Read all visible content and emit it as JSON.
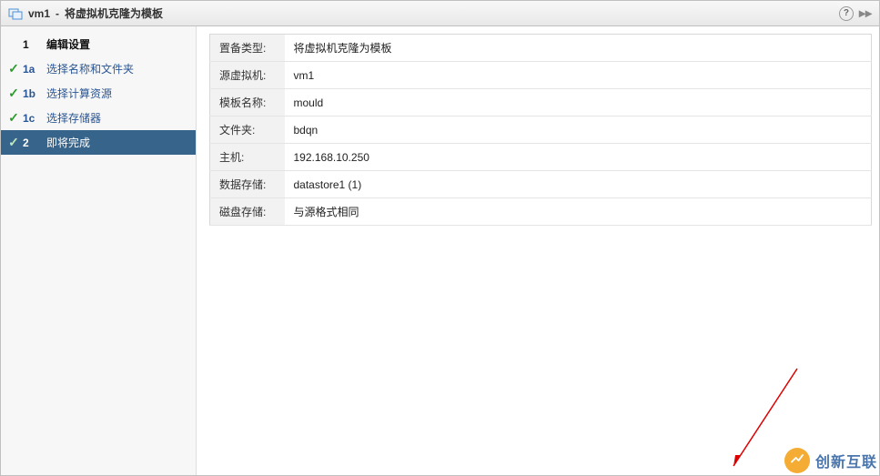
{
  "title": {
    "vm_name": "vm1",
    "separator": " - ",
    "action": "将虚拟机克隆为模板"
  },
  "sidebar": {
    "parent_number": "1",
    "parent_label": "编辑设置",
    "steps": [
      {
        "num": "1a",
        "label": "选择名称和文件夹",
        "checked": true
      },
      {
        "num": "1b",
        "label": "选择计算资源",
        "checked": true
      },
      {
        "num": "1c",
        "label": "选择存储器",
        "checked": true
      }
    ],
    "active_number": "2",
    "active_label": "即将完成"
  },
  "summary": [
    {
      "key": "置备类型:",
      "value": "将虚拟机克隆为模板"
    },
    {
      "key": "源虚拟机:",
      "value": "vm1"
    },
    {
      "key": "模板名称:",
      "value": "mould"
    },
    {
      "key": "文件夹:",
      "value": "bdqn"
    },
    {
      "key": "主机:",
      "value": "192.168.10.250"
    },
    {
      "key": "数据存储:",
      "value": "datastore1 (1)"
    },
    {
      "key": "磁盘存储:",
      "value": "与源格式相同"
    }
  ],
  "watermark": {
    "text": "创新互联"
  },
  "help_tooltip": "?"
}
